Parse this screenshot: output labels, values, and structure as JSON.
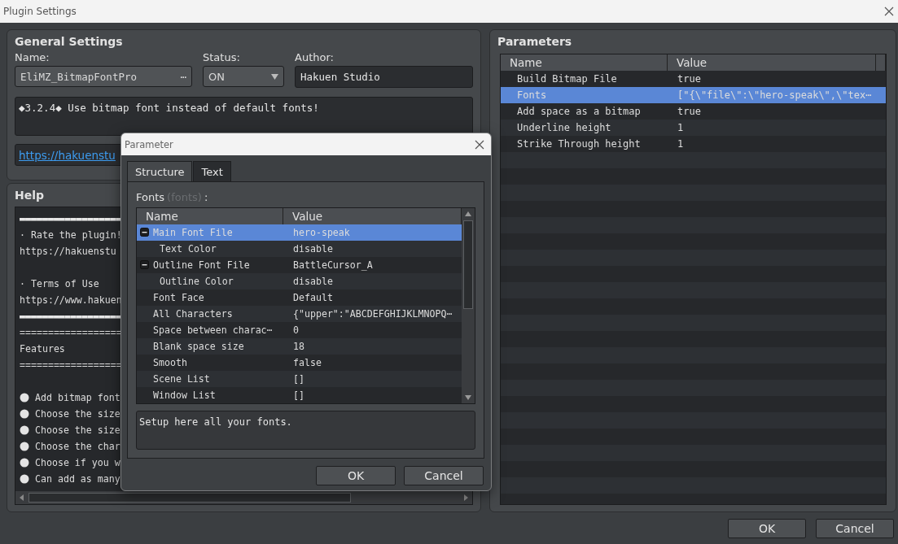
{
  "window": {
    "title": "Plugin Settings"
  },
  "general_settings": {
    "title": "General Settings",
    "name_label": "Name:",
    "name_value": "EliMZ_BitmapFontPro",
    "name_button": "⋯",
    "status_label": "Status:",
    "status_value": "ON",
    "author_label": "Author:",
    "author_value": "Hakuen Studio",
    "description": "◆3.2.4◆ Use bitmap font instead of default fonts!",
    "link": "https://hakuenstu"
  },
  "help": {
    "title": "Help",
    "lines": [
      {
        "kind": "rule",
        "text": "▬▬▬▬▬▬▬▬▬▬▬▬▬▬▬▬▬▬"
      },
      {
        "kind": "text",
        "text": "· Rate the plugin!"
      },
      {
        "kind": "text",
        "text": "https://hakuenstu"
      },
      {
        "kind": "blank"
      },
      {
        "kind": "text",
        "text": "· Terms of Use"
      },
      {
        "kind": "text",
        "text": "https://www.hakuen"
      },
      {
        "kind": "rule",
        "text": "▬▬▬▬▬▬▬▬▬▬▬▬▬▬▬▬▬▬"
      },
      {
        "kind": "text",
        "text": "=================="
      },
      {
        "kind": "text",
        "text": "Features"
      },
      {
        "kind": "text",
        "text": "=================="
      },
      {
        "kind": "blank"
      },
      {
        "kind": "bullet",
        "text": "Add bitmap font"
      },
      {
        "kind": "bullet",
        "text": "Choose the size"
      },
      {
        "kind": "bullet",
        "text": "Choose the size"
      },
      {
        "kind": "bullet",
        "text": "Choose the char"
      },
      {
        "kind": "bullet",
        "text": "Choose if you w"
      },
      {
        "kind": "bullet",
        "text": "Can add as many"
      }
    ]
  },
  "parameters": {
    "title": "Parameters",
    "columns": [
      "Name",
      "Value"
    ],
    "rows": [
      {
        "name": "Build Bitmap File",
        "value": "true",
        "selected": false
      },
      {
        "name": "Fonts",
        "value": "[\"{\\\"file\\\":\\\"hero-speak\\\",\\\"tex⋯",
        "selected": true
      },
      {
        "name": "Add space as a bitmap",
        "value": "true",
        "selected": false
      },
      {
        "name": "Underline height",
        "value": "1",
        "selected": false
      },
      {
        "name": "Strike Through height",
        "value": "1",
        "selected": false
      }
    ]
  },
  "dialog": {
    "title": "Parameter",
    "tabs": [
      {
        "label": "Structure",
        "selected": true
      },
      {
        "label": "Text",
        "selected": false
      }
    ],
    "field_label": "Fonts",
    "field_key": "(fonts)",
    "field_suffix": ":",
    "columns": [
      "Name",
      "Value"
    ],
    "rows": [
      {
        "name": "Main Font File",
        "value": "hero-speak",
        "selected": true,
        "expanded": true,
        "children": [
          {
            "name": "Text Color",
            "value": "disable",
            "selected": false
          }
        ]
      },
      {
        "name": "Outline Font File",
        "value": "BattleCursor_A",
        "selected": false,
        "expanded": true,
        "children": [
          {
            "name": "Outline Color",
            "value": "disable",
            "selected": false
          }
        ]
      },
      {
        "name": "Font Face",
        "value": "Default",
        "selected": false
      },
      {
        "name": "All Characters",
        "value": "{\"upper\":\"ABCDEFGHIJKLMNOPQ⋯",
        "selected": false
      },
      {
        "name": "Space between charac⋯",
        "value": "0",
        "selected": false
      },
      {
        "name": "Blank space size",
        "value": "18",
        "selected": false
      },
      {
        "name": "Smooth",
        "value": "false",
        "selected": false
      },
      {
        "name": "Scene List",
        "value": "[]",
        "selected": false
      },
      {
        "name": "Window List",
        "value": "[]",
        "selected": false
      }
    ],
    "description": "Setup here all your fonts.",
    "buttons": [
      "OK",
      "Cancel"
    ]
  },
  "buttons": [
    "OK",
    "Cancel"
  ]
}
